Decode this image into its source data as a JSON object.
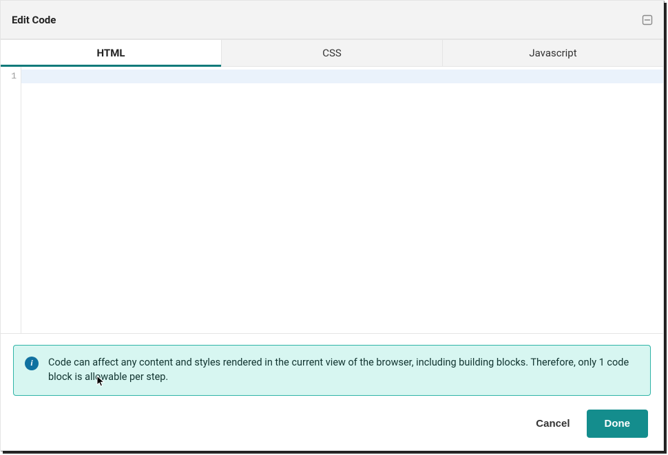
{
  "header": {
    "title": "Edit Code"
  },
  "tabs": [
    {
      "label": "HTML",
      "active": true
    },
    {
      "label": "CSS",
      "active": false
    },
    {
      "label": "Javascript",
      "active": false
    }
  ],
  "editor": {
    "gutter_first_line": "1",
    "content": ""
  },
  "alert": {
    "icon_letter": "i",
    "message": "Code can affect any content and styles rendered in the current view of the browser, including building blocks. Therefore, only 1 code block is allowable per step."
  },
  "actions": {
    "cancel_label": "Cancel",
    "done_label": "Done"
  }
}
